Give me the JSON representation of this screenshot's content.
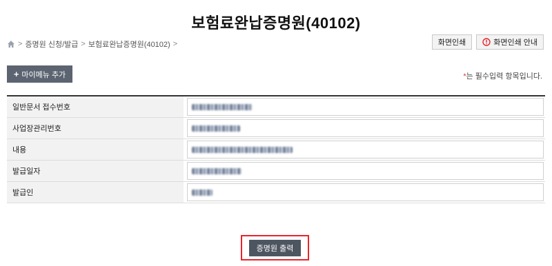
{
  "page": {
    "title": "보험료완납증명원(40102)"
  },
  "breadcrumb": {
    "items": [
      "증명원 신청/발급",
      "보험료완납증명원(40102)"
    ]
  },
  "toolbar": {
    "print_label": "화면인쇄",
    "print_guide_label": "화면인쇄 안내"
  },
  "mymenu": {
    "label": "마이메뉴 추가"
  },
  "required_note": {
    "star": "*",
    "text": "는 필수입력 항목입니다."
  },
  "form": {
    "rows": [
      {
        "label": "일반문서 접수번호"
      },
      {
        "label": "사업장관리번호"
      },
      {
        "label": "내용"
      },
      {
        "label": "발급일자"
      },
      {
        "label": "발급인"
      }
    ]
  },
  "actions": {
    "print_certificate_label": "증명원 출력"
  },
  "colors": {
    "accent_red": "#e8232a",
    "button_dark": "#4d5560",
    "mymenu_bg": "#5b6470"
  },
  "icons": {
    "home": "home-icon",
    "alert": "alert-circle-icon",
    "plus": "plus-icon"
  }
}
